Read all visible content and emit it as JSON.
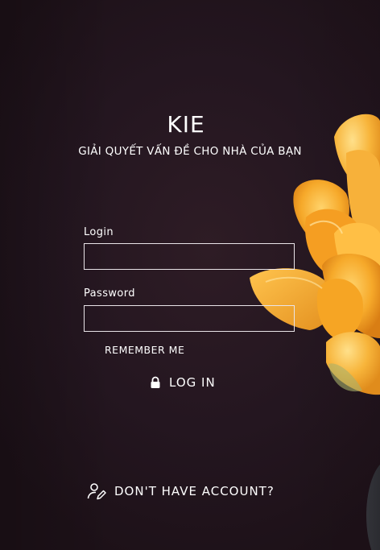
{
  "brand": {
    "title": "KIE",
    "tagline": "GIẢI QUYẾT VẤN ĐỀ CHO NHÀ CỦA BẠN"
  },
  "form": {
    "login_label": "Login",
    "login_value": "",
    "password_label": "Password",
    "password_value": "",
    "remember_label": "REMEMBER ME",
    "submit_label": "LOG IN",
    "submit_icon": "lock-icon"
  },
  "signup": {
    "label": "DON'T HAVE ACCOUNT?",
    "icon": "user-edit-icon"
  },
  "colors": {
    "background": "#241620",
    "text": "#ffffff",
    "flower_primary": "#f5a623",
    "flower_highlight": "#ffc94a"
  }
}
